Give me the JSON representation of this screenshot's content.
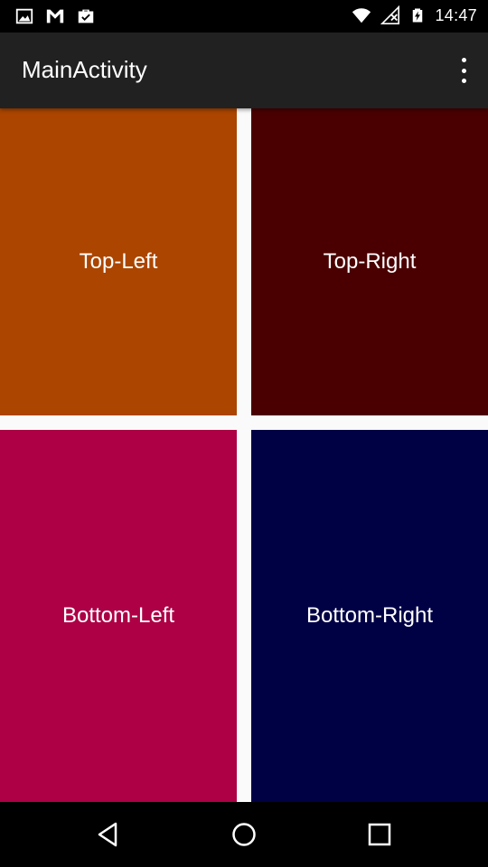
{
  "status_bar": {
    "time": "14:47",
    "icons": [
      "image-icon",
      "gmail-icon",
      "briefcase-check-icon",
      "wifi-icon",
      "no-signal-icon",
      "battery-charging-icon"
    ]
  },
  "app_bar": {
    "title": "MainActivity",
    "overflow_icon": "more-vert-icon"
  },
  "panels": [
    {
      "label": "Top-Left",
      "color": "#ab4500"
    },
    {
      "label": "Top-Right",
      "color": "#4a0000"
    },
    {
      "label": "Bottom-Left",
      "color": "#ad0045"
    },
    {
      "label": "Bottom-Right",
      "color": "#000045"
    }
  ],
  "nav_bar": {
    "icons": [
      "back-icon",
      "home-icon",
      "recents-icon"
    ]
  }
}
